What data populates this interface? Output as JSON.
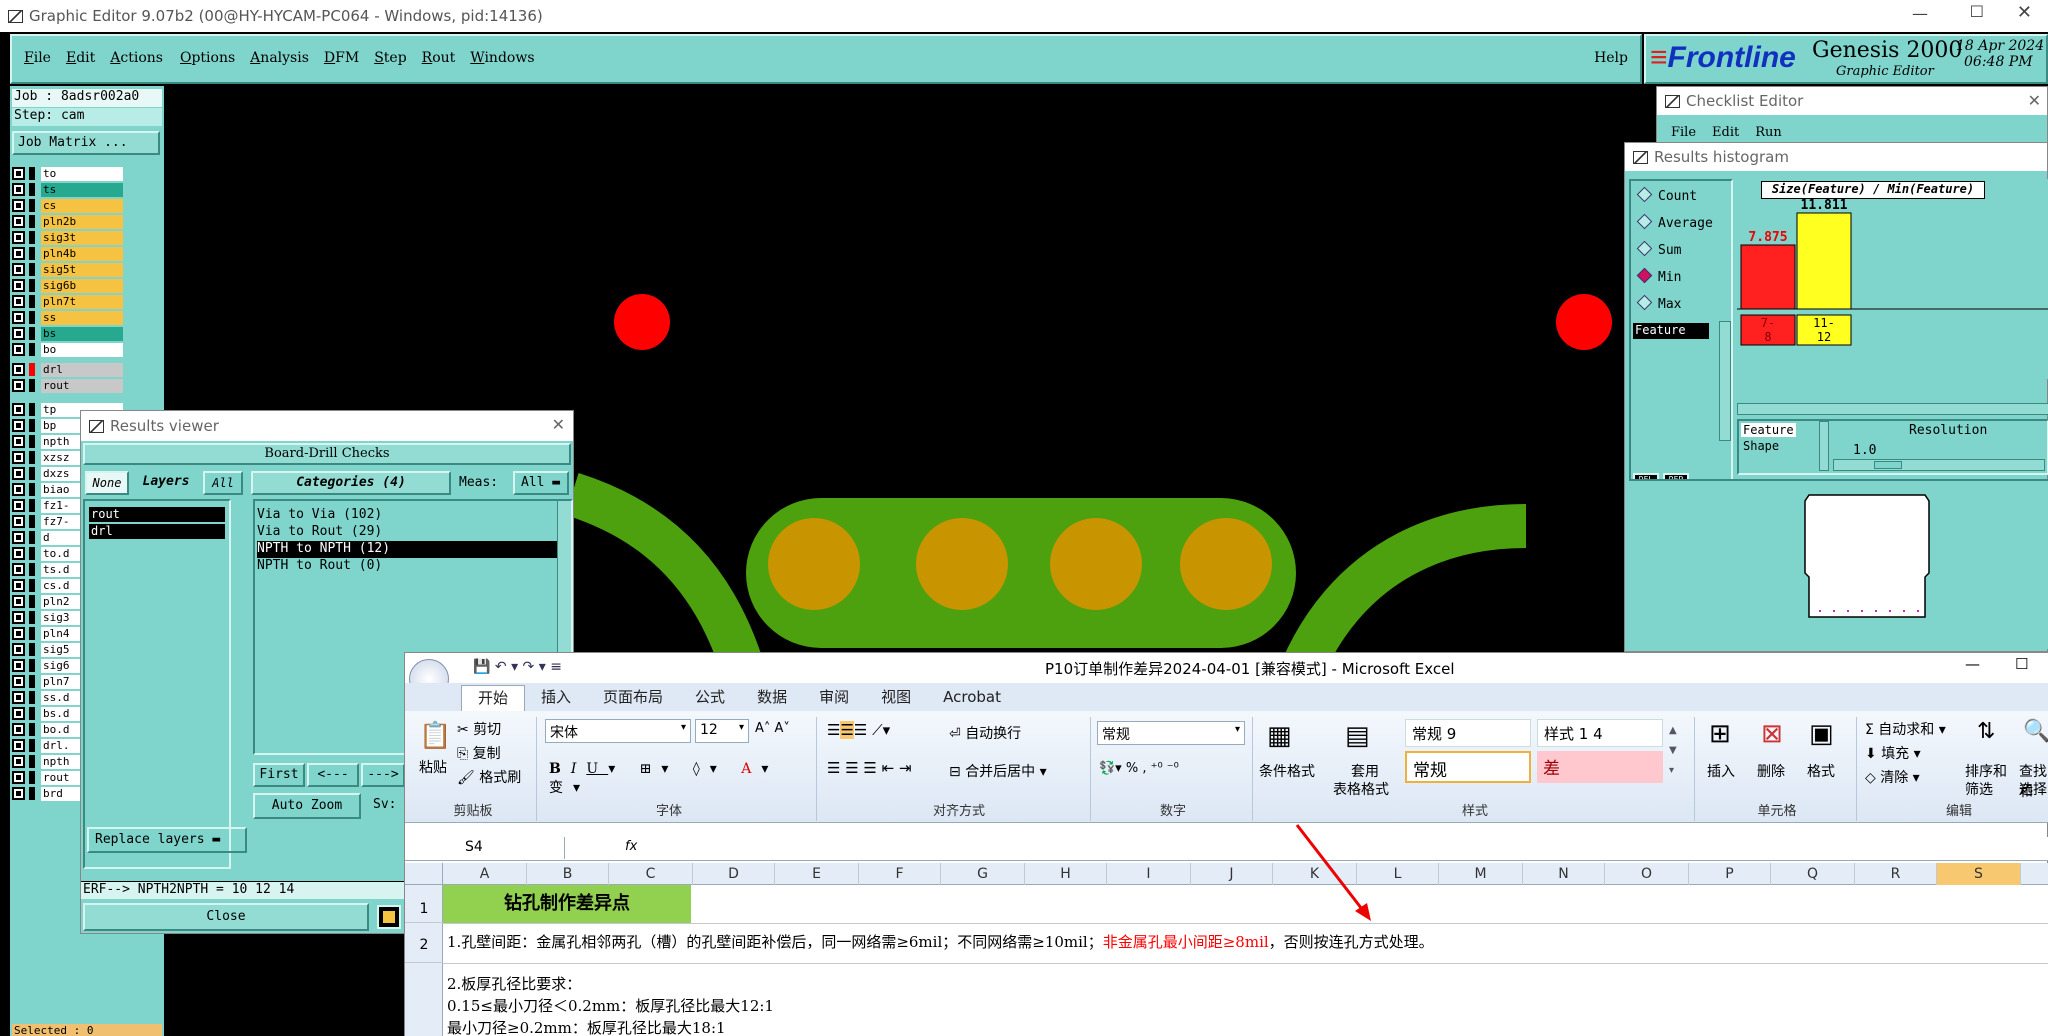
{
  "genesis": {
    "title": "Graphic Editor 9.07b2 (00@HY-HYCAM-PC064 - Windows, pid:14136)",
    "menu": [
      "File",
      "Edit",
      "Actions",
      "Options",
      "Analysis",
      "DFM",
      "Step",
      "Rout",
      "Windows"
    ],
    "help": "Help",
    "brand": "Frontline",
    "product": "Genesis 2000",
    "subtitle": "Graphic Editor",
    "date": "18 Apr 2024",
    "time": "06:48 PM",
    "job": "Job : 8adsr002a0",
    "step": "Step: cam",
    "job_matrix": "Job Matrix ...",
    "layers_top": [
      {
        "name": "to",
        "color": "#ffffff"
      },
      {
        "name": "ts",
        "color": "#26a98f"
      },
      {
        "name": "cs",
        "color": "#f5c242"
      },
      {
        "name": "pln2b",
        "color": "#f5c242"
      },
      {
        "name": "sig3t",
        "color": "#f5c242"
      },
      {
        "name": "pln4b",
        "color": "#f5c242"
      },
      {
        "name": "sig5t",
        "color": "#f5c242"
      },
      {
        "name": "sig6b",
        "color": "#f5c242"
      },
      {
        "name": "pln7t",
        "color": "#f5c242"
      },
      {
        "name": "ss",
        "color": "#f5c242"
      },
      {
        "name": "bs",
        "color": "#26a98f"
      },
      {
        "name": "bo",
        "color": "#ffffff"
      }
    ],
    "layers_mid": [
      {
        "name": "drl",
        "color": "#c8c8c8"
      },
      {
        "name": "rout",
        "color": "#c8c8c8"
      }
    ],
    "layers_low": [
      "tp",
      "bp",
      "npth",
      "xzsz",
      "dxzs",
      "biao",
      "fz1-",
      "fz7-",
      "d",
      "to.d",
      "ts.d",
      "cs.d",
      "pln2",
      "sig3",
      "pln4",
      "sig5",
      "sig6",
      "pln7",
      "ss.d",
      "bs.d",
      "bo.d",
      "drl.",
      "npth",
      "rout",
      "brd"
    ],
    "selected": "Selected : 0",
    "colors": {
      "teal": "#7fd4cc",
      "green": "#4ea10e",
      "gold": "#c89400",
      "red": "#ff0000"
    }
  },
  "results_viewer": {
    "title": "Results viewer",
    "header": "Board-Drill Checks",
    "none": "None",
    "layers": "Layers",
    "all": "All",
    "categories": "Categories (4)",
    "meas": "Meas:",
    "meas_val": "All",
    "layer_list": [
      "rout",
      "drl"
    ],
    "items": [
      "Via to Via  (102)",
      "Via to Rout  (29)",
      "NPTH to NPTH  (12)",
      "NPTH to Rout  (0)"
    ],
    "first": "First",
    "prev": "<---",
    "next": "--->",
    "auto_zoom": "Auto Zoom",
    "sv": "Sv:",
    "replace": "Replace layers",
    "erf": "ERF--> NPTH2NPTH = 10 12 14",
    "close": "Close"
  },
  "checklist": {
    "title": "Checklist Editor",
    "menu": [
      "File",
      "Edit",
      "Run"
    ]
  },
  "histogram": {
    "title": "Results histogram",
    "options": [
      {
        "label": "Count",
        "selected": false
      },
      {
        "label": "Average",
        "selected": false
      },
      {
        "label": "Sum",
        "selected": false
      },
      {
        "label": "Min",
        "selected": true
      },
      {
        "label": "Max",
        "selected": false
      }
    ],
    "feature": "Feature",
    "chart_title": "Size(Feature) / Min(Feature)",
    "bars": [
      {
        "value": "7.875",
        "range": "7-8",
        "color": "#ff2020"
      },
      {
        "value": "11.811",
        "range": "11-12",
        "color": "#ffff20"
      }
    ],
    "feature_shape_1": "Feature",
    "feature_shape_2": "Shape",
    "resolution": "Resolution",
    "resolution_val": "1.0",
    "btn1": "DEL",
    "btn2": "REP"
  },
  "excel": {
    "title": "P10订单制作差异2024-04-01  [兼容模式] - Microsoft Excel",
    "tabs": [
      "开始",
      "插入",
      "页面布局",
      "公式",
      "数据",
      "审阅",
      "视图",
      "Acrobat"
    ],
    "clipboard": {
      "paste": "粘贴",
      "cut": "剪切",
      "copy": "复制",
      "format": "格式刷",
      "label": "剪贴板"
    },
    "font": {
      "name": "宋体",
      "size": "12",
      "label": "字体"
    },
    "align": {
      "wrap": "自动换行",
      "merge": "合并后居中",
      "label": "对齐方式"
    },
    "number": {
      "format": "常规",
      "label": "数字"
    },
    "styles": {
      "cond": "条件格式",
      "table1": "套用",
      "table2": "表格格式",
      "s1": "常规 9",
      "s2": "样式 1 4",
      "s3": "常规",
      "s4": "差",
      "label": "样式"
    },
    "cells": {
      "insert": "插入",
      "delete": "删除",
      "format": "格式",
      "label": "单元格"
    },
    "edit": {
      "sum": "自动求和",
      "fill": "填充",
      "clear": "清除",
      "sort1": "排序和",
      "sort2": "筛选",
      "find1": "查找和",
      "find2": "选择",
      "label": "编辑"
    },
    "namebox": "S4",
    "fx": "fx",
    "columns": [
      "A",
      "B",
      "C",
      "D",
      "E",
      "F",
      "G",
      "H",
      "I",
      "J",
      "K",
      "L",
      "M",
      "N",
      "O",
      "P",
      "Q",
      "R",
      "S"
    ],
    "rows": [
      "1",
      "2"
    ],
    "heading": "钻孔制作差异点",
    "line1a": "1.孔壁间距：金属孔相邻两孔（槽）的孔壁间距补偿后，同一网络需≥6mil；不同网络需≥10mil；",
    "line1b": "非金属孔最小间距≥8mil",
    "line1c": "，否则按连孔方式处理。",
    "line2": "2.板厚孔径比要求：",
    "line3": "0.15≤最小刀径＜0.2mm：板厚孔径比最大12:1",
    "line4": "最小刀径≥0.2mm：板厚孔径比最大18:1"
  }
}
